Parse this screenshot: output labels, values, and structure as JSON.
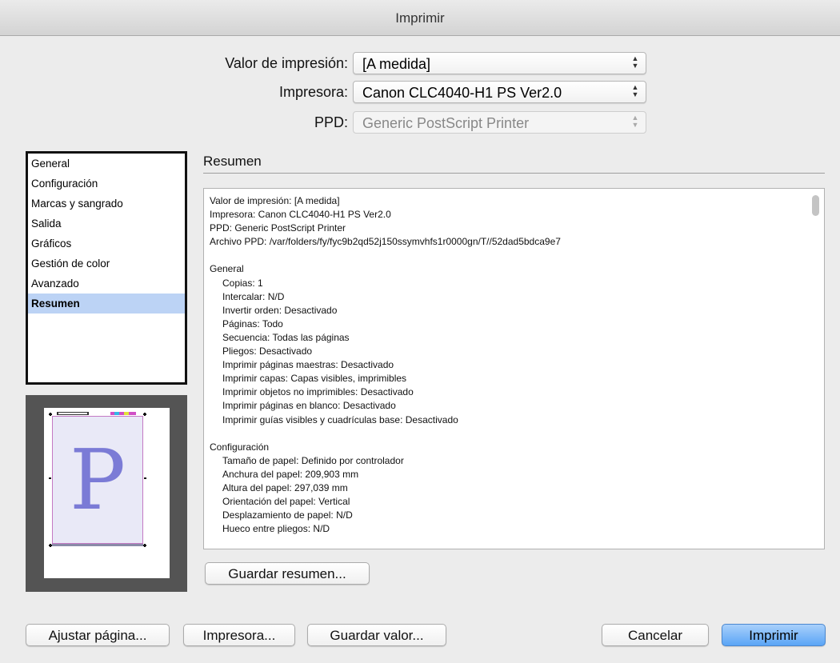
{
  "window": {
    "title": "Imprimir"
  },
  "top_fields": {
    "preset": {
      "label": "Valor de impresión:",
      "value": "[A medida]"
    },
    "printer": {
      "label": "Impresora:",
      "value": "Canon CLC4040-H1 PS Ver2.0"
    },
    "ppd": {
      "label": "PPD:",
      "value": "Generic PostScript Printer"
    }
  },
  "categories": [
    "General",
    "Configuración",
    "Marcas y sangrado",
    "Salida",
    "Gráficos",
    "Gestión de color",
    "Avanzado",
    "Resumen"
  ],
  "selected_category": "Resumen",
  "preview": {
    "letter": "P"
  },
  "summary": {
    "title": "Resumen",
    "lines": [
      {
        "text": "Valor de impresión: [A medida]",
        "indent": false
      },
      {
        "text": "Impresora: Canon CLC4040-H1 PS Ver2.0",
        "indent": false
      },
      {
        "text": "PPD: Generic PostScript Printer",
        "indent": false
      },
      {
        "text": "Archivo PPD: /var/folders/fy/fyc9b2qd52j150ssymvhfs1r0000gn/T//52dad5bdca9e7",
        "indent": false
      },
      {
        "text": "",
        "indent": false
      },
      {
        "text": "General",
        "indent": false
      },
      {
        "text": "Copias: 1",
        "indent": true
      },
      {
        "text": "Intercalar: N/D",
        "indent": true
      },
      {
        "text": "Invertir orden: Desactivado",
        "indent": true
      },
      {
        "text": "Páginas: Todo",
        "indent": true
      },
      {
        "text": "Secuencia: Todas las páginas",
        "indent": true
      },
      {
        "text": "Pliegos: Desactivado",
        "indent": true
      },
      {
        "text": "Imprimir páginas maestras: Desactivado",
        "indent": true
      },
      {
        "text": "Imprimir capas: Capas visibles, imprimibles",
        "indent": true
      },
      {
        "text": "Imprimir objetos no imprimibles: Desactivado",
        "indent": true
      },
      {
        "text": "Imprimir páginas en blanco: Desactivado",
        "indent": true
      },
      {
        "text": "Imprimir guías visibles y cuadrículas base: Desactivado",
        "indent": true
      },
      {
        "text": "",
        "indent": false
      },
      {
        "text": "Configuración",
        "indent": false
      },
      {
        "text": "Tamaño de papel: Definido por controlador",
        "indent": true
      },
      {
        "text": "Anchura del papel: 209,903 mm",
        "indent": true
      },
      {
        "text": "Altura del papel: 297,039 mm",
        "indent": true
      },
      {
        "text": "Orientación del papel: Vertical",
        "indent": true
      },
      {
        "text": "Desplazamiento de papel: N/D",
        "indent": true
      },
      {
        "text": "Hueco entre pliegos: N/D",
        "indent": true
      }
    ],
    "save_label": "Guardar resumen..."
  },
  "buttons": {
    "page_setup": "Ajustar página...",
    "printer": "Impresora...",
    "save_preset": "Guardar valor...",
    "cancel": "Cancelar",
    "print": "Imprimir"
  },
  "icons": {
    "select_arrows": "up-down-chevron-icon"
  }
}
